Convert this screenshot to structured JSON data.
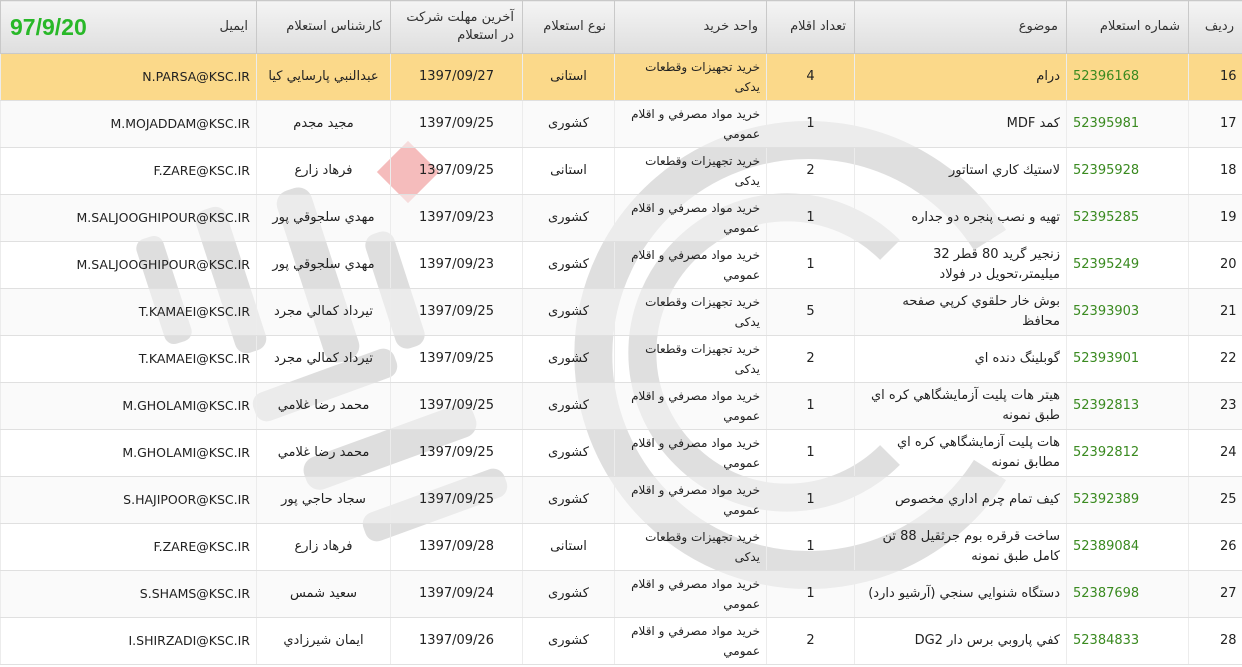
{
  "overlay_date": "97/9/20",
  "header": {
    "radif": "ردیف",
    "number": "شماره استعلام",
    "subject": "موضوع",
    "count": "تعداد اقلام",
    "unit": "واحد خرید",
    "type": "نوع استعلام",
    "deadline": "آخرین مهلت شرکت در استعلام",
    "expert": "کارشناس استعلام",
    "email": "ایمیل"
  },
  "rows": [
    {
      "radif": "16",
      "number": "52396168",
      "subject": "درام",
      "count": "4",
      "unit": "خرید تجهیزات وقطعات یدکی",
      "type": "استانی",
      "deadline": "1397/09/27",
      "expert": "عبدالنبي پارسايي كيا",
      "email": "N.PARSA@KSC.IR"
    },
    {
      "radif": "17",
      "number": "52395981",
      "subject": "كمد MDF",
      "count": "1",
      "unit": "خريد مواد مصرفي و اقلام عمومي",
      "type": "كشوری",
      "deadline": "1397/09/25",
      "expert": "مجيد مجدم",
      "email": "M.MOJADDAM@KSC.IR"
    },
    {
      "radif": "18",
      "number": "52395928",
      "subject": "لاستيك كاري استاتور",
      "count": "2",
      "unit": "خرید تجهیزات وقطعات یدکی",
      "type": "استانی",
      "deadline": "1397/09/25",
      "expert": "فرهاد زارع",
      "email": "F.ZARE@KSC.IR"
    },
    {
      "radif": "19",
      "number": "52395285",
      "subject": "تهيه و نصب پنجره دو جداره",
      "count": "1",
      "unit": "خريد مواد مصرفي و اقلام عمومي",
      "type": "كشوری",
      "deadline": "1397/09/23",
      "expert": "مهدي سلجوقي پور",
      "email": "M.SALJOOGHIPOUR@KSC.IR"
    },
    {
      "radif": "20",
      "number": "52395249",
      "subject": "زنجير گريد 80 قطر 32 ميليمتر،تحويل در فولاد",
      "count": "1",
      "unit": "خريد مواد مصرفي و اقلام عمومي",
      "type": "كشوری",
      "deadline": "1397/09/23",
      "expert": "مهدي سلجوقي پور",
      "email": "M.SALJOOGHIPOUR@KSC.IR"
    },
    {
      "radif": "21",
      "number": "52393903",
      "subject": "بوش خار حلقوي كرپي صفحه محافظ",
      "count": "5",
      "unit": "خرید تجهیزات وقطعات یدکی",
      "type": "كشوری",
      "deadline": "1397/09/25",
      "expert": "تيرداد كمالي مجرد",
      "email": "T.KAMAEI@KSC.IR"
    },
    {
      "radif": "22",
      "number": "52393901",
      "subject": "گوبلينگ دنده اي",
      "count": "2",
      "unit": "خرید تجهیزات وقطعات یدکی",
      "type": "كشوری",
      "deadline": "1397/09/25",
      "expert": "تيرداد كمالي مجرد",
      "email": "T.KAMAEI@KSC.IR"
    },
    {
      "radif": "23",
      "number": "52392813",
      "subject": "هيتر هات پليت آزمايشگاهي كره اي طبق نمونه",
      "count": "1",
      "unit": "خريد مواد مصرفي و اقلام عمومي",
      "type": "كشوری",
      "deadline": "1397/09/25",
      "expert": "محمد رضا غلامي",
      "email": "M.GHOLAMI@KSC.IR"
    },
    {
      "radif": "24",
      "number": "52392812",
      "subject": "هات پليت آزمايشگاهي كره اي مطابق نمونه",
      "count": "1",
      "unit": "خريد مواد مصرفي و اقلام عمومي",
      "type": "كشوری",
      "deadline": "1397/09/25",
      "expert": "محمد رضا غلامي",
      "email": "M.GHOLAMI@KSC.IR"
    },
    {
      "radif": "25",
      "number": "52392389",
      "subject": "كيف تمام چرم اداري مخصوص",
      "count": "1",
      "unit": "خريد مواد مصرفي و اقلام عمومي",
      "type": "كشوری",
      "deadline": "1397/09/25",
      "expert": "سجاد حاجي پور",
      "email": "S.HAJIPOOR@KSC.IR"
    },
    {
      "radif": "26",
      "number": "52389084",
      "subject": "ساخت قرقره بوم جرثقيل 88 تن كامل طبق نمونه",
      "count": "1",
      "unit": "خرید تجهیزات وقطعات یدکی",
      "type": "استانی",
      "deadline": "1397/09/28",
      "expert": "فرهاد زارع",
      "email": "F.ZARE@KSC.IR"
    },
    {
      "radif": "27",
      "number": "52387698",
      "subject": "دستگاه شنوايي سنجي (آرشيو دارد)",
      "count": "1",
      "unit": "خريد مواد مصرفي و اقلام عمومي",
      "type": "كشوری",
      "deadline": "1397/09/24",
      "expert": "سعيد شمس",
      "email": "S.SHAMS@KSC.IR"
    },
    {
      "radif": "28",
      "number": "52384833",
      "subject": "كفي پاروبي برس دار DG2",
      "count": "2",
      "unit": "خريد مواد مصرفي و اقلام عمومي",
      "type": "كشوری",
      "deadline": "1397/09/26",
      "expert": "ايمان شيرزادي",
      "email": "I.SHIRZADI@KSC.IR"
    }
  ],
  "colors": {
    "highlight_row": "#fbd98a",
    "number_text": "#3a8a20",
    "overlay_date": "#28b828"
  },
  "watermark_icon": "company-logo-watermark-icon"
}
